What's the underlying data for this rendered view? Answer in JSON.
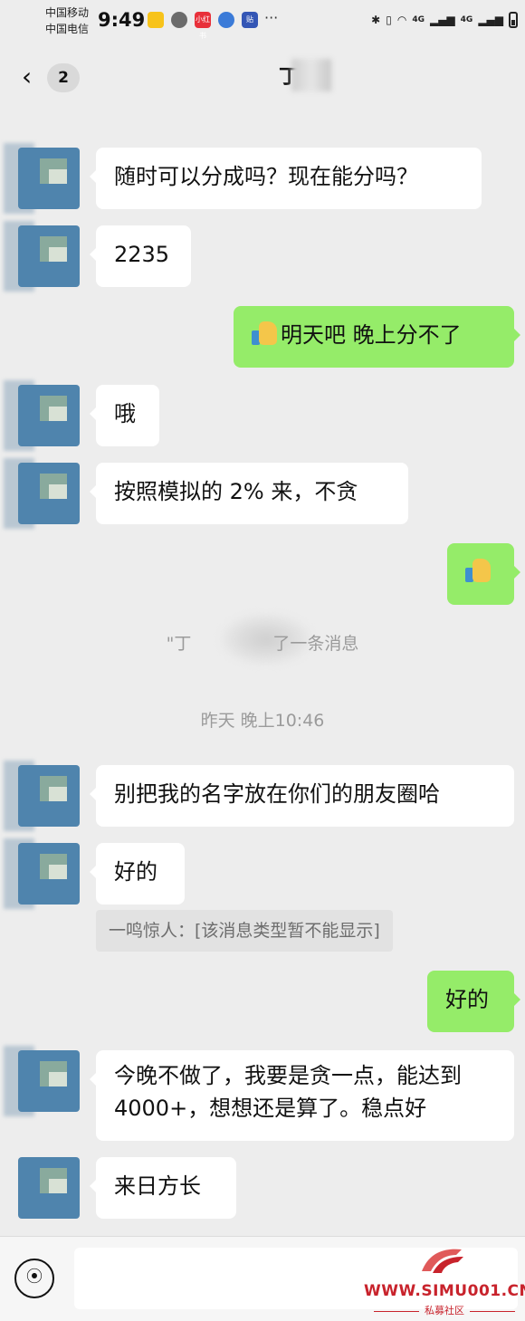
{
  "status_bar": {
    "carrier_1": "中国移动",
    "carrier_2": "中国电信",
    "time": "9:49",
    "apps": [
      "weibo-icon",
      "wechat-icon",
      "xiaohongshu-icon",
      "browser-icon",
      "tieba-icon"
    ],
    "app_badge_xhs": "小红书",
    "app_badge_tieba": "贴",
    "more": "···",
    "network_1": "4G",
    "network_2": "4G"
  },
  "nav": {
    "unread_count": "2",
    "title": "丁"
  },
  "messages": [
    {
      "side": "left",
      "text": "随时可以分成吗？现在能分吗？"
    },
    {
      "side": "left",
      "text": "2235"
    },
    {
      "side": "right",
      "text": "明天吧 晚上分不了",
      "emoji": "thumbs-up-icon"
    },
    {
      "side": "left",
      "text": "哦"
    },
    {
      "side": "left",
      "text": "按照模拟的 2% 来，不贪"
    },
    {
      "side": "right",
      "text": "",
      "emoji": "thumbs-up-icon"
    },
    {
      "side": "left",
      "text": "别把我的名字放在你们的朋友圈哈"
    },
    {
      "side": "left",
      "text": "好的"
    },
    {
      "side": "right",
      "text": "好的"
    },
    {
      "side": "left",
      "text": "今晚不做了，我要是贪一点，能达到 4000+，想想还是算了。稳点好"
    },
    {
      "side": "left",
      "text": "来日方长"
    }
  ],
  "system": {
    "recall_prefix": "\"丁",
    "recall_suffix": "了一条消息",
    "timestamp": "昨天 晚上10:46"
  },
  "quote": {
    "text": "一鸣惊人：[该消息类型暂不能显示]"
  },
  "input": {
    "placeholder": ""
  },
  "watermark": {
    "site": "WWW.SIMU001.CN",
    "name": "私募社区"
  },
  "colors": {
    "background": "#ededed",
    "outgoing_bubble": "#95ec69",
    "incoming_bubble": "#ffffff",
    "avatar": "#4f84ad",
    "watermark": "#c8232c"
  }
}
